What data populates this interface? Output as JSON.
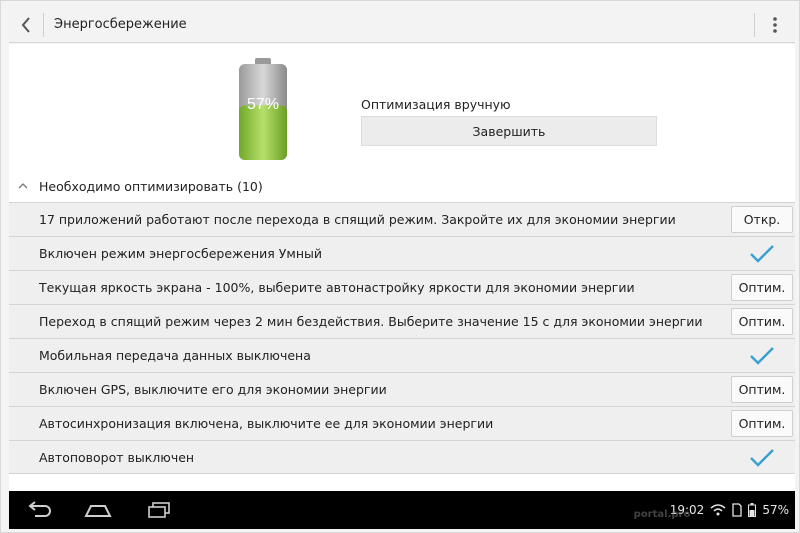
{
  "header": {
    "title": "Энергосбережение"
  },
  "battery": {
    "percent_label": "57%",
    "level": 0.57,
    "color": "#8cc63f"
  },
  "manual": {
    "label": "Оптимизация вручную",
    "finish_label": "Завершить"
  },
  "section": {
    "label": "Необходимо оптимизировать (10)"
  },
  "items": [
    {
      "text": "17 приложений работают после перехода в спящий режим. Закройте их для экономии энергии",
      "action": "Откр."
    },
    {
      "text": "Включен режим энергосбережения Умный",
      "done": true
    },
    {
      "text": "Текущая яркость экрана - 100%, выберите автонастройку яркости для экономии энергии",
      "action": "Оптим."
    },
    {
      "text": "Переход в спящий режим через 2 мин бездействия. Выберите значение 15 с для экономии энергии",
      "action": "Оптим."
    },
    {
      "text": "Мобильная передача данных выключена",
      "done": true
    },
    {
      "text": "Включен GPS, выключите его для экономии энергии",
      "action": "Оптим."
    },
    {
      "text": "Автосинхронизация включена, выключите ее для экономии энергии",
      "action": "Оптим."
    },
    {
      "text": "Автоповорот выключен",
      "done": true
    }
  ],
  "statusbar": {
    "time": "19:02",
    "battery": "57%"
  },
  "watermark": "portal.pro",
  "colors": {
    "check": "#3aa0d0",
    "accent_green": "#8cc63f"
  }
}
